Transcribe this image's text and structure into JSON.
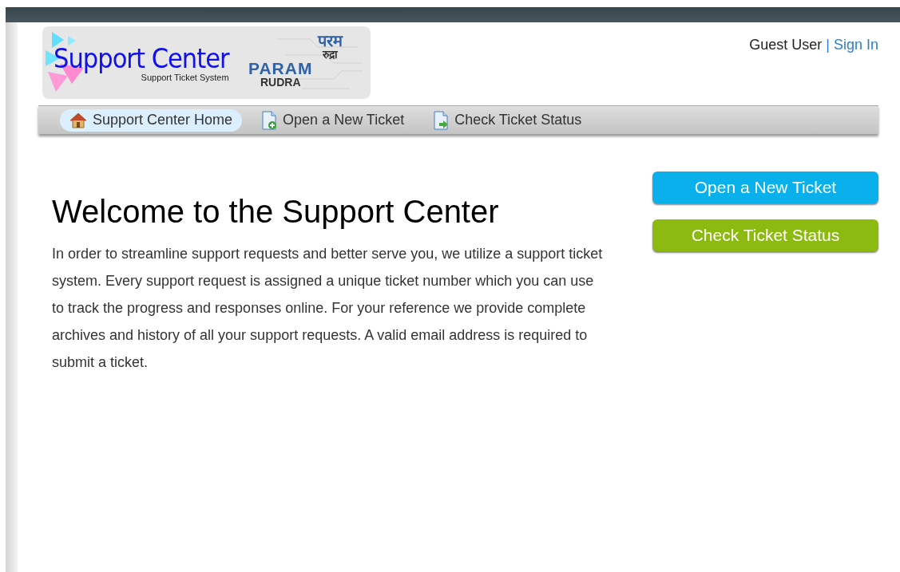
{
  "logo": {
    "title": "Support Center",
    "subtitle": "Support Ticket System",
    "partner_line1": "PARAM",
    "partner_line2": "RUDRA",
    "partner_hindi1": "परम",
    "partner_hindi2": "रुद्रा"
  },
  "user": {
    "name": "Guest User",
    "separator": "|",
    "link": "Sign In"
  },
  "nav": [
    {
      "label": "Support Center Home",
      "kind": "home",
      "selected": true
    },
    {
      "label": "Open a New Ticket",
      "kind": "new",
      "selected": false
    },
    {
      "label": "Check Ticket Status",
      "kind": "status",
      "selected": false
    }
  ],
  "welcome": {
    "heading": "Welcome to the Support Center",
    "body": "In order to streamline support requests and better serve you, we utilize a support ticket system. Every support request is assigned a unique ticket number which you can use to track the progress and responses online. For your reference we provide complete archives and history of all your support requests. A valid email address is required to submit a ticket."
  },
  "actions": [
    {
      "label": "Open a New Ticket",
      "color": "#0ab0ec"
    },
    {
      "label": "Check Ticket Status",
      "color": "#8cba11"
    }
  ]
}
